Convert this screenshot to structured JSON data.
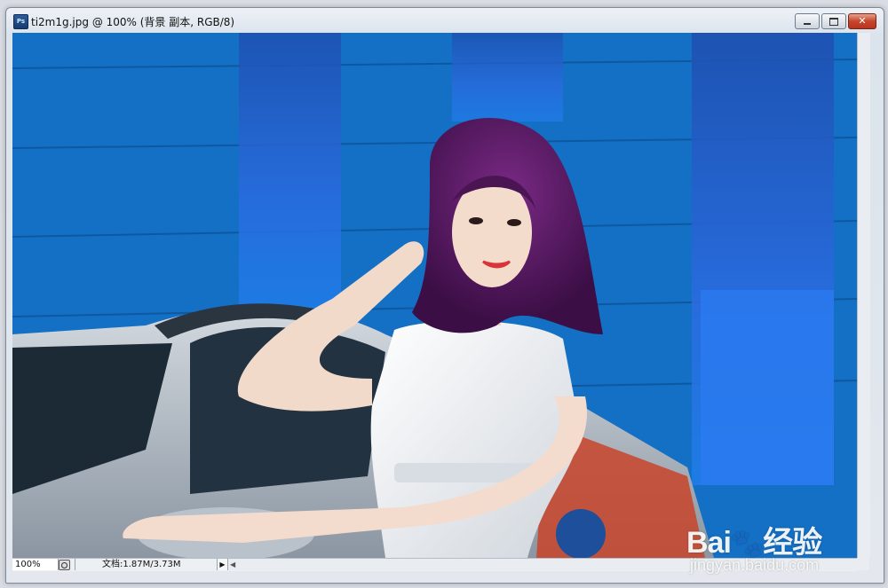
{
  "window": {
    "title": "ti2m1g.jpg @ 100% (背景 副本, RGB/8)",
    "app_icon_text": "Ps",
    "buttons": {
      "minimize": "minimize-icon",
      "maximize": "maximize-icon",
      "close": "close-icon"
    }
  },
  "canvas": {
    "content": "photo"
  },
  "statusbar": {
    "zoom": "100%",
    "doc_info": "文档:1.87M/3.73M",
    "arrow": "▶",
    "scroll_left": "◀"
  },
  "watermark": {
    "brand": "Bai",
    "brand_suffix": "经验",
    "url": "jingyan.baidu.com"
  },
  "colors": {
    "background": "#0f62b4",
    "hair": "#5a1a60",
    "dress": "#eef0f2",
    "car": "#aab3bd"
  }
}
